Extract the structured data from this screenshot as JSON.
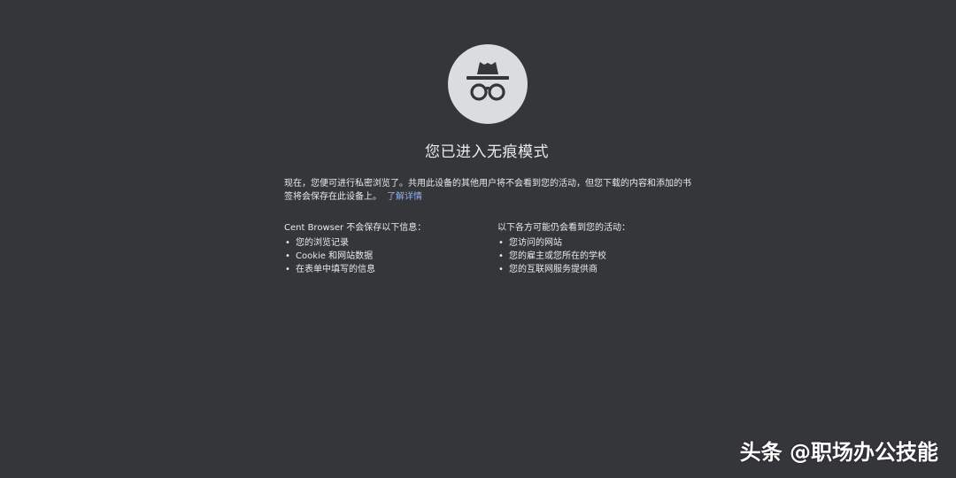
{
  "colors": {
    "background": "#35363a",
    "text": "#e8eaed",
    "link": "#8ab4f8",
    "icon_circle": "#dadce0",
    "icon_fg": "#35363a"
  },
  "icon": {
    "name": "incognito-icon"
  },
  "title": "您已进入无痕模式",
  "intro": {
    "text": "现在，您便可进行私密浏览了。共用此设备的其他用户将不会看到您的活动，但您下载的内容和添加的书签将会保存在此设备上。",
    "learn_more": "了解详情"
  },
  "not_saved": {
    "heading": "Cent Browser 不会保存以下信息：",
    "items": [
      "您的浏览记录",
      "Cookie 和网站数据",
      "在表单中填写的信息"
    ]
  },
  "still_visible": {
    "heading": "以下各方可能仍会看到您的活动：",
    "items": [
      "您访问的网站",
      "您的雇主或您所在的学校",
      "您的互联网服务提供商"
    ]
  },
  "watermark": "头条 @职场办公技能"
}
